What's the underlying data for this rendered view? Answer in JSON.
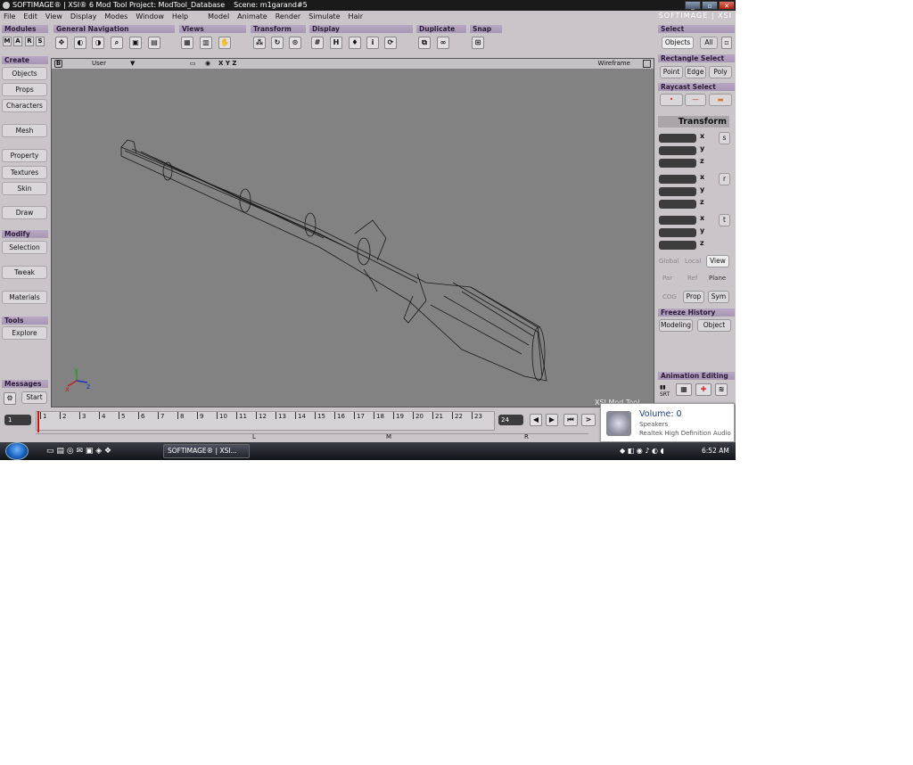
{
  "window": {
    "title": "SOFTIMAGE® | XSI® 6 Mod Tool Project: ModTool_Database",
    "scene": "Scene: m1garand#5",
    "brand": "SOFTIMAGE | XSI"
  },
  "menu": [
    "File",
    "Edit",
    "View",
    "Display",
    "Modes",
    "Window",
    "Help",
    "Model",
    "Animate",
    "Render",
    "Simulate",
    "Hair"
  ],
  "toolbar": {
    "modules": "Modules",
    "mars": [
      "M",
      "A",
      "R",
      "S"
    ],
    "general_navigation": "General Navigation",
    "views": "Views",
    "transform": "Transform",
    "display": "Display",
    "duplicate": "Duplicate",
    "snap": "Snap"
  },
  "left_panel": {
    "create": "Create",
    "create_items": [
      "Objects",
      "Props",
      "Characters",
      "Mesh",
      "Property",
      "Textures",
      "Skin",
      "Draw"
    ],
    "modify": "Modify",
    "modify_items": [
      "Selection",
      "Tweak",
      "Materials"
    ],
    "tools": "Tools",
    "tools_items": [
      "Explore"
    ],
    "messages": "Messages",
    "start": "Start"
  },
  "viewport": {
    "label": "B",
    "camera": "User",
    "axes": "X Y Z",
    "mode": "Wireframe",
    "watermark": "XSI Mod Tool"
  },
  "right_panel": {
    "select": "Select",
    "objects": "Objects",
    "all": "All",
    "rect_select": "Rectangle Select",
    "rect_items": [
      "Point",
      "Edge",
      "Poly"
    ],
    "raycast_select": "Raycast Select",
    "transform_title": "Transform",
    "axes": [
      "x",
      "y",
      "z"
    ],
    "srt": [
      "s",
      "r",
      "t"
    ],
    "ref_row1": [
      "Global",
      "Local",
      "View"
    ],
    "ref_row2": [
      "Par",
      "Ref",
      "Plane"
    ],
    "ref_row3": [
      "COG",
      "Prop",
      "Sym"
    ],
    "freeze_history": "Freeze History",
    "freeze_items": [
      "Modeling",
      "Object"
    ],
    "animation_editing": "Animation Editing",
    "srt_label": "SRT"
  },
  "timeline": {
    "start_frame": "1",
    "end_frame": "24",
    "ticks": [
      "1",
      "2",
      "3",
      "4",
      "5",
      "6",
      "7",
      "8",
      "9",
      "10",
      "11",
      "12",
      "13",
      "14",
      "15",
      "16",
      "17",
      "18",
      "19",
      "20",
      "21",
      "22",
      "23"
    ],
    "markers": [
      "L",
      "M",
      "R"
    ]
  },
  "notification": {
    "title": "Volume: 0",
    "line1": "Speakers",
    "line2": "Realtek High Definition Audio"
  },
  "taskbar": {
    "task": "SOFTIMAGE® | XSI...",
    "clock": "6:52 AM"
  }
}
